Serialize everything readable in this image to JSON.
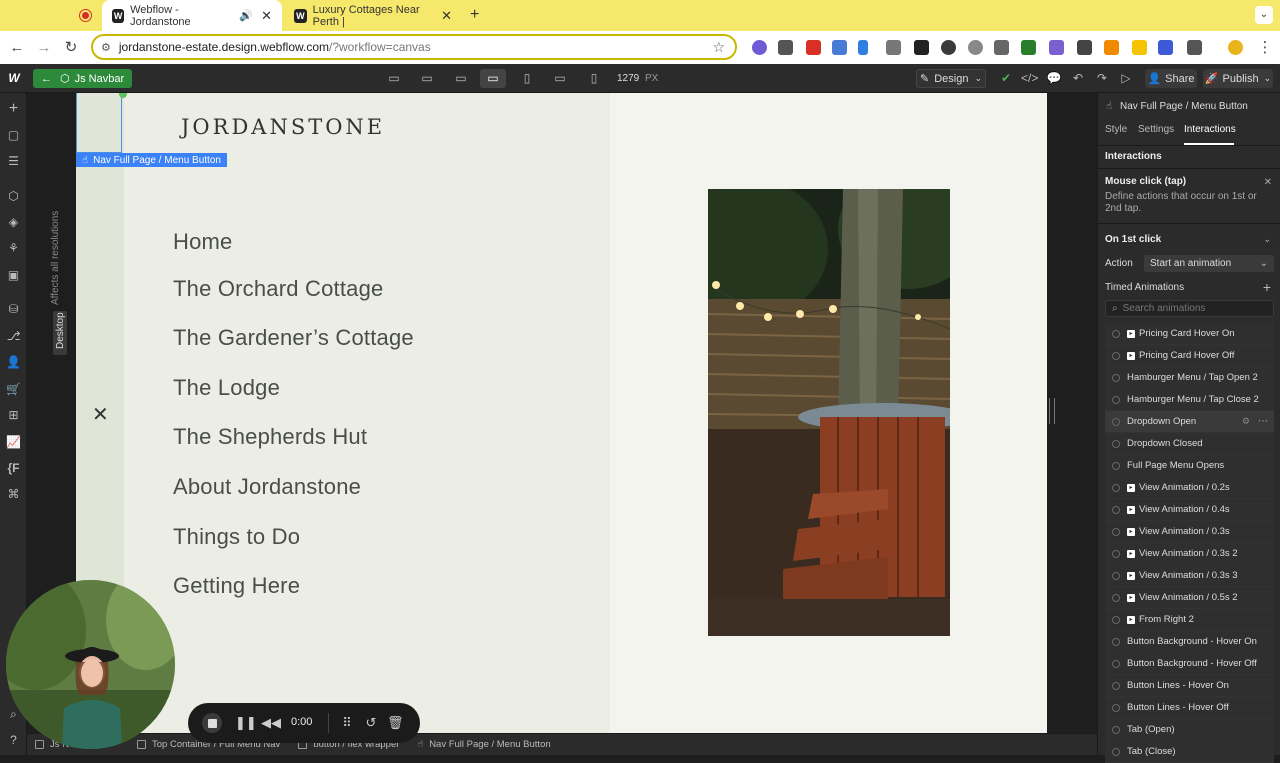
{
  "browser": {
    "tabs": [
      {
        "title": "Webflow - Jordanstone",
        "active": true
      },
      {
        "title": "Luxury Cottages Near Perth |",
        "active": false
      }
    ],
    "url_host": "jordanstone-estate.design.webflow.com",
    "url_path": "/?workflow=canvas",
    "new_tab_label": "+"
  },
  "webflow": {
    "component_label": "Js Navbar",
    "width_value": "1279",
    "width_unit": "PX",
    "design_label": "Design",
    "share_label": "Share",
    "publish_label": "Publish"
  },
  "left_strip": {
    "affects_label": "Affects all resolutions",
    "breakpoint_label": "Desktop"
  },
  "canvas": {
    "selection_label": "Nav Full Page / Menu Button",
    "logo": "JORDANSTONE",
    "close_glyph": "✕",
    "menu_links": [
      "Home",
      "The Orchard Cottage",
      "The Gardener’s Cottage",
      "The Lodge",
      "The Shepherds Hut",
      "About Jordanstone",
      "Things to Do",
      "Getting Here"
    ]
  },
  "panel": {
    "element_title": "Nav Full Page / Menu Button",
    "tabs": [
      "Style",
      "Settings",
      "Interactions"
    ],
    "active_tab": "Interactions",
    "section_title": "Interactions",
    "trigger_title": "Mouse click (tap)",
    "trigger_desc_1": "Define actions that occur on 1st or",
    "trigger_desc_2": "2nd tap.",
    "first_click": "On 1st click",
    "action_label": "Action",
    "action_value": "Start an animation",
    "timed_label": "Timed Animations",
    "search_placeholder": "Search animations",
    "animations": [
      {
        "name": "Pricing Card Hover On",
        "badge": true
      },
      {
        "name": "Pricing Card Hover Off",
        "badge": true
      },
      {
        "name": "Hamburger Menu / Tap Open 2",
        "badge": false
      },
      {
        "name": "Hamburger Menu / Tap Close 2",
        "badge": false
      },
      {
        "name": "Dropdown Open",
        "badge": false,
        "hover": true
      },
      {
        "name": "Dropdown Closed",
        "badge": false
      },
      {
        "name": "Full Page Menu Opens",
        "badge": false
      },
      {
        "name": "View Animation / 0.2s",
        "badge": true
      },
      {
        "name": "View Animation / 0.4s",
        "badge": true
      },
      {
        "name": "View Animation / 0.3s",
        "badge": true
      },
      {
        "name": "View Animation / 0.3s 2",
        "badge": true
      },
      {
        "name": "View Animation / 0.3s 3",
        "badge": true
      },
      {
        "name": "View Animation / 0.5s 2",
        "badge": true
      },
      {
        "name": "From Right 2",
        "badge": true
      },
      {
        "name": "Button Background - Hover On",
        "badge": false
      },
      {
        "name": "Button Background - Hover Off",
        "badge": false
      },
      {
        "name": "Button Lines - Hover On",
        "badge": false
      },
      {
        "name": "Button Lines - Hover Off",
        "badge": false
      },
      {
        "name": "Tab (Open)",
        "badge": false
      },
      {
        "name": "Tab (Close)",
        "badge": false
      }
    ]
  },
  "breadcrumbs": [
    "Js N",
    "Top Container / Full Menu Nav",
    "button / flex wrapper",
    "Nav Full Page / Menu Button"
  ],
  "recorder": {
    "time": "0:00"
  }
}
